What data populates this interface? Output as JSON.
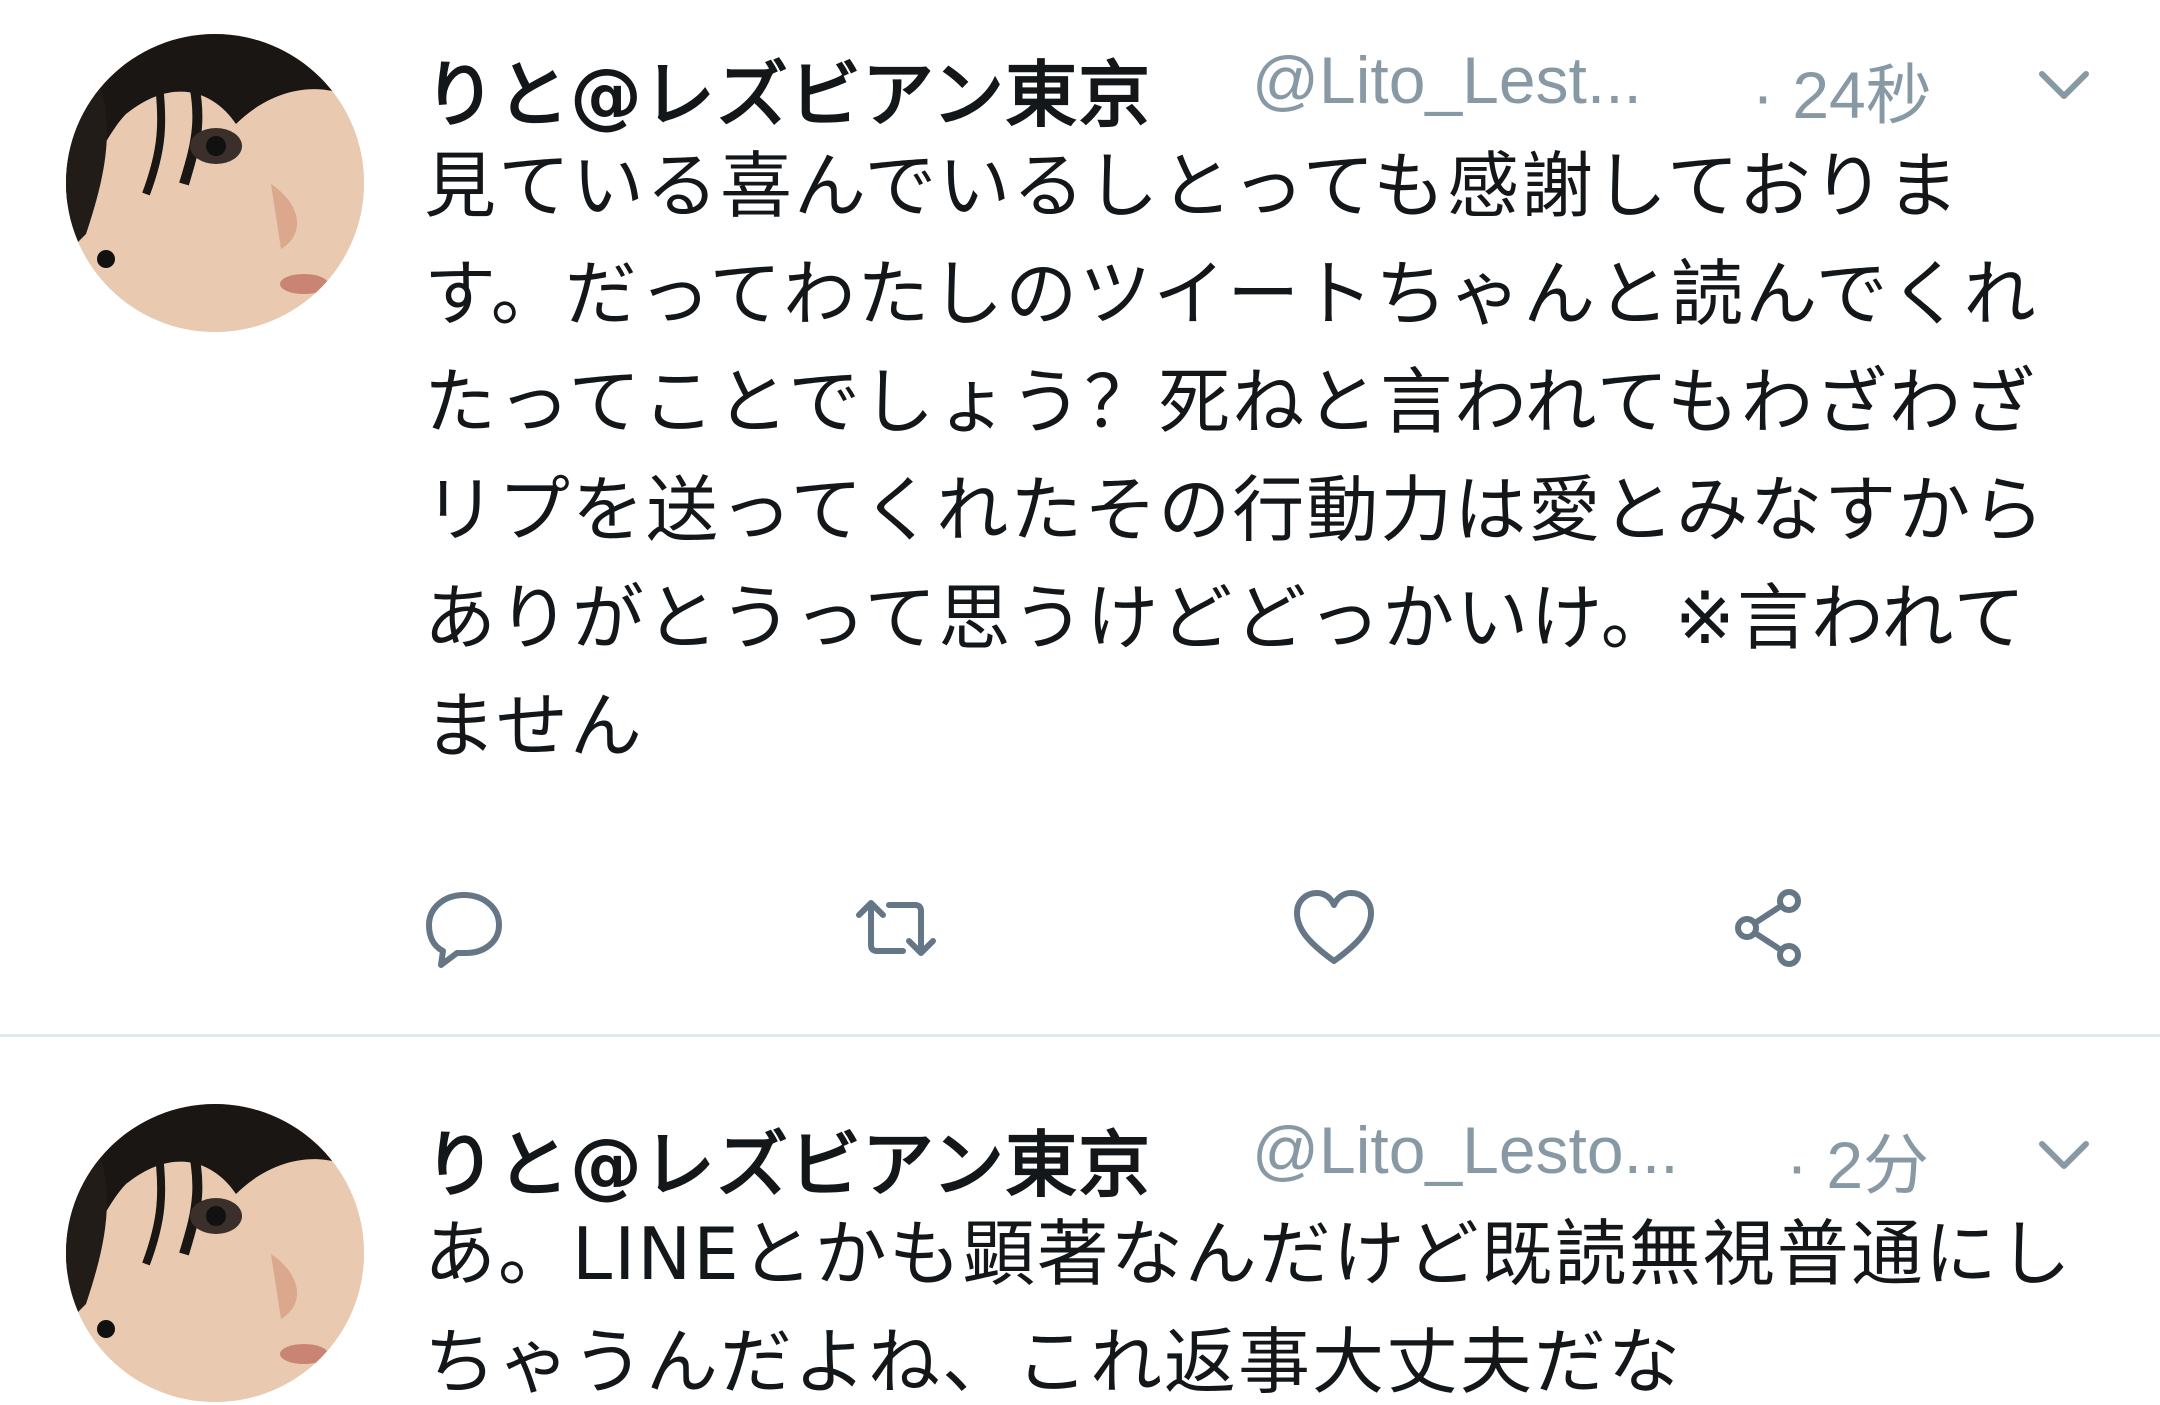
{
  "tweets": [
    {
      "display_name": "りと@レズビアン東京",
      "handle": "@Lito_Lest...",
      "time": "· 24秒",
      "text": "見ている喜んでいるしとっても感謝しております。だってわたしのツイートちゃんと読んでくれたってことでしょう？死ねと言われてもわざわざリプを送ってくれたその行動力は愛とみなすからありがとうって思うけどどっかいけ。※言われてません",
      "actions": {
        "reply": "reply-icon",
        "retweet": "retweet-icon",
        "like": "heart-icon",
        "share": "share-icon"
      }
    },
    {
      "display_name": "りと@レズビアン東京",
      "handle": "@Lito_Lesto...",
      "time": "· 2分",
      "text": "あ。LINEとかも顕著なんだけど既読無視普通にしちゃうんだよね、これ返事大丈夫だな"
    }
  ],
  "colors": {
    "secondary_text": "#8899a6",
    "primary_text": "#14171a",
    "divider": "#e1e8ed",
    "icon": "#657786"
  }
}
